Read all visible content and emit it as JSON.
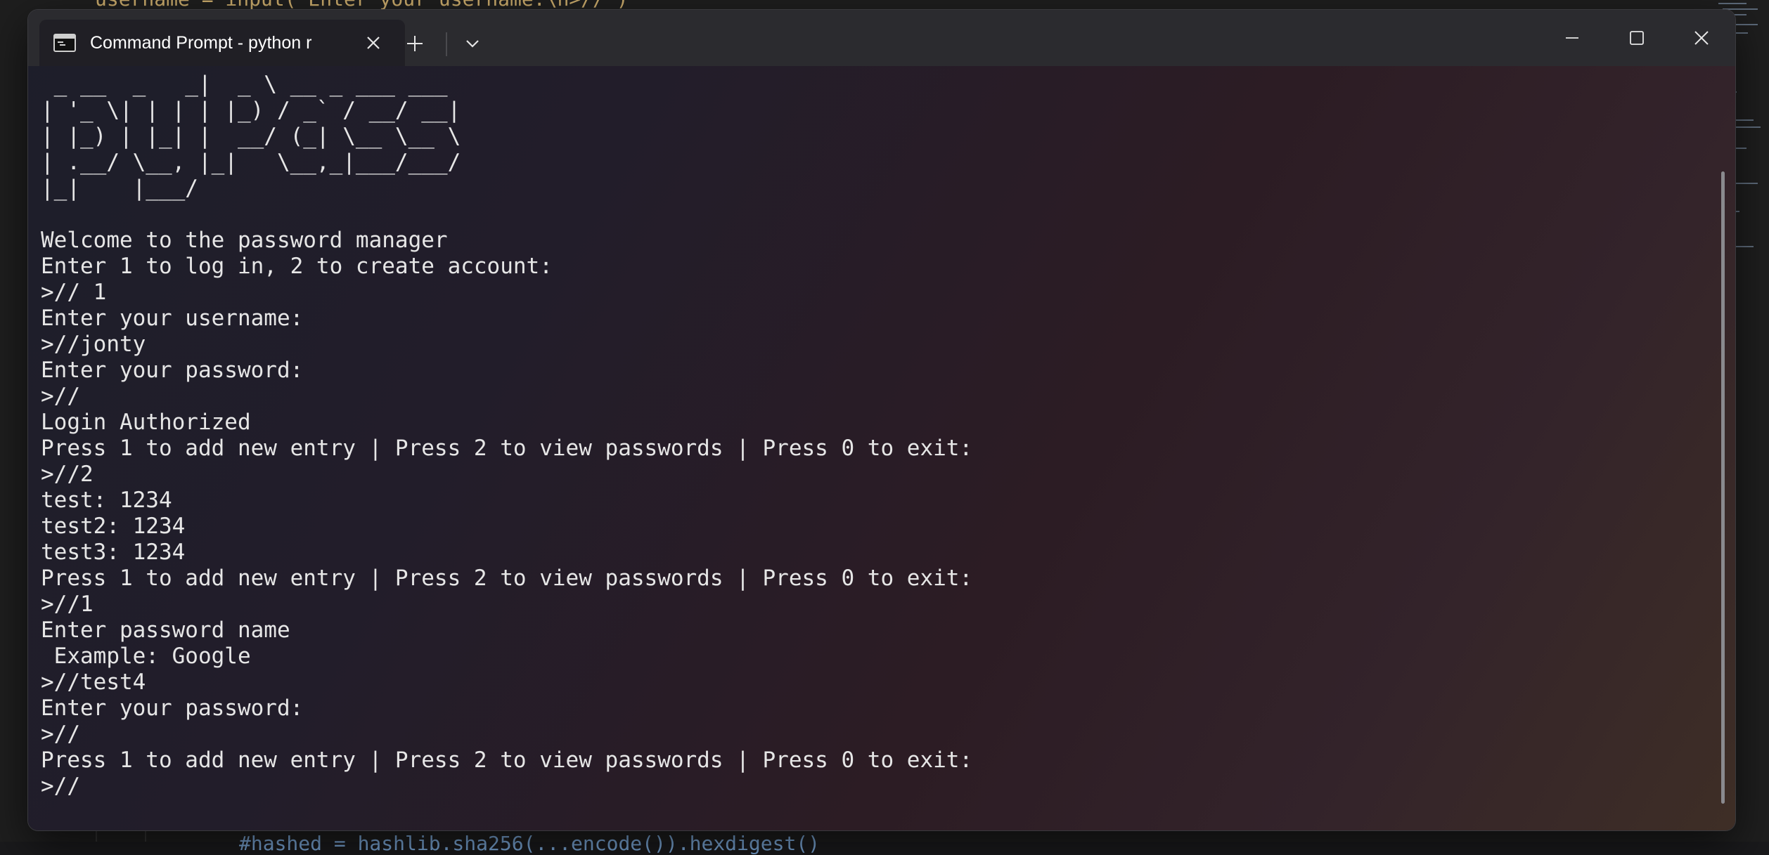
{
  "background": {
    "code_top": "username = input(\"Enter your username:\\n>//\")",
    "code_bottom": "#hashed = hashlib.sha256(...encode()).hexdigest()"
  },
  "window": {
    "tab_title": "Command Prompt - python r",
    "icons": {
      "tab": "terminal-icon",
      "close_tab": "close-icon",
      "new_tab": "plus-icon",
      "dropdown": "chevron-down-icon",
      "minimize": "minimize-icon",
      "maximize": "maximize-icon",
      "close_window": "close-icon"
    }
  },
  "terminal": {
    "lines": [
      " _ __  _   _|  _ \\ __ _ ___ ___",
      "| '_ \\| | | | |_) / _` / __/ __|",
      "| |_) | |_| |  __/ (_| \\__ \\__ \\",
      "| .__/ \\__, |_|   \\__,_|___/___/",
      "|_|    |___/",
      "",
      "Welcome to the password manager",
      "Enter 1 to log in, 2 to create account:",
      ">// 1",
      "Enter your username:",
      ">//jonty",
      "Enter your password:",
      ">//",
      "Login Authorized",
      "Press 1 to add new entry | Press 2 to view passwords | Press 0 to exit:",
      ">//2",
      "test: 1234",
      "test2: 1234",
      "test3: 1234",
      "Press 1 to add new entry | Press 2 to view passwords | Press 0 to exit:",
      ">//1",
      "Enter password name",
      " Example: Google",
      ">//test4",
      "Enter your password:",
      ">//",
      "Press 1 to add new entry | Press 2 to view passwords | Press 0 to exit:",
      ">//"
    ]
  }
}
